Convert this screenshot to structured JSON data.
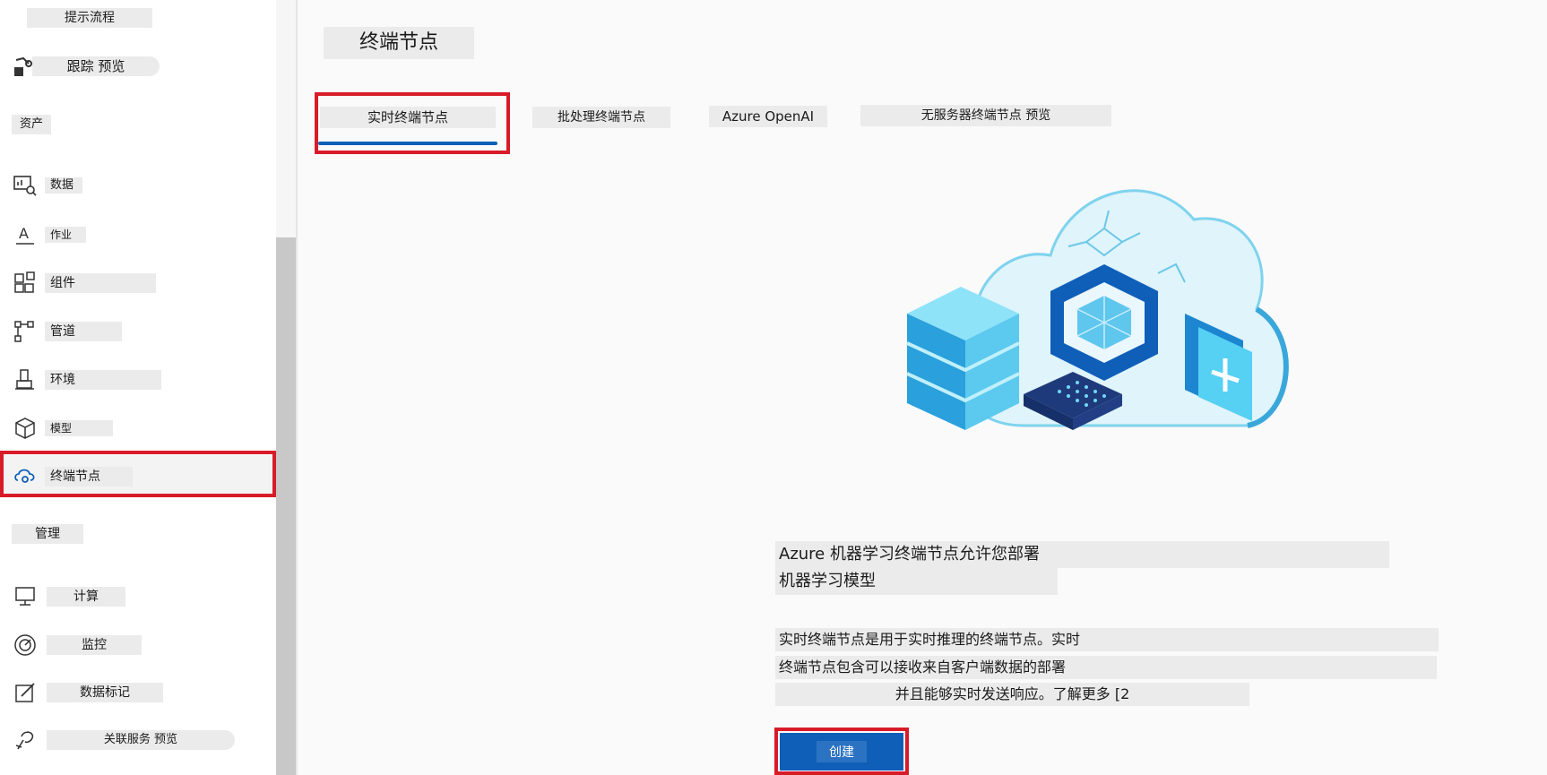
{
  "sidebar": {
    "prompt_flow": "提示流程",
    "tracing": "跟踪 预览",
    "assets_header": "资产",
    "items": [
      {
        "label": "数据",
        "icon": "data-icon"
      },
      {
        "label": "作业",
        "icon": "jobs-icon"
      },
      {
        "label": "组件",
        "icon": "components-icon"
      },
      {
        "label": "管道",
        "icon": "pipelines-icon"
      },
      {
        "label": "环境",
        "icon": "environments-icon"
      },
      {
        "label": "模型",
        "icon": "models-icon"
      },
      {
        "label": "终端节点",
        "icon": "endpoints-icon"
      }
    ],
    "manage_header": "管理",
    "manage_items": [
      {
        "label": "计算",
        "icon": "compute-icon"
      },
      {
        "label": "监控",
        "icon": "monitoring-icon"
      },
      {
        "label": "数据标记",
        "icon": "data-labeling-icon"
      },
      {
        "label": "关联服务 预览",
        "icon": "linked-services-icon"
      }
    ]
  },
  "main": {
    "title": "终端节点",
    "tabs": [
      {
        "label": "实时终端节点",
        "selected": true
      },
      {
        "label": "批处理终端节点",
        "selected": false
      },
      {
        "label": "Azure OpenAI",
        "selected": false
      },
      {
        "label": "无服务器终端节点 预览",
        "selected": false
      }
    ],
    "heading_line1": "Azure 机器学习终端节点允许您部署",
    "heading_line2": "机器学习模型",
    "desc_line1": "实时终端节点是用于实时推理的终端节点。实时",
    "desc_line2": "终端节点包含可以接收来自客户端数据的部署",
    "desc_line3": "并且能够实时发送响应。了解更多 [2",
    "create_button": "创建"
  },
  "colors": {
    "highlight": "#d81b29",
    "accent": "#0f5fb8"
  }
}
